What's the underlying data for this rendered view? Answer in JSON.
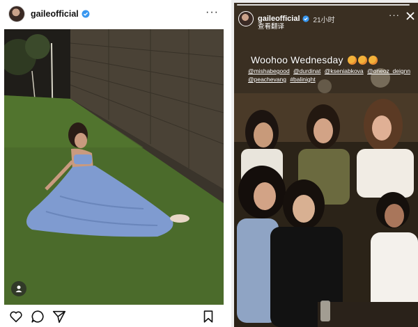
{
  "post": {
    "username": "gaileofficial",
    "more_label": "···",
    "icons": {
      "like": "heart-icon",
      "comment": "comment-icon",
      "share": "share-icon",
      "save": "bookmark-icon",
      "user_tag": "person-icon",
      "verified": "verified-badge-icon"
    }
  },
  "story": {
    "username": "gaileofficial",
    "time": "21小时",
    "translate_label": "查看翻译",
    "more_label": "···",
    "caption": "Woohoo Wednesday",
    "mentions": [
      "@mishabegood",
      "@durdinat",
      "@kseniabkova",
      "@oneoz_deignn",
      "@peachevang",
      "#balinight"
    ],
    "icons": {
      "close": "close-icon",
      "verified": "verified-badge-icon"
    }
  },
  "colors": {
    "verified_blue": "#3897f0",
    "post_bg": "#ffffff",
    "grass": "#4b6b2b",
    "dress": "#7f9bd0"
  }
}
